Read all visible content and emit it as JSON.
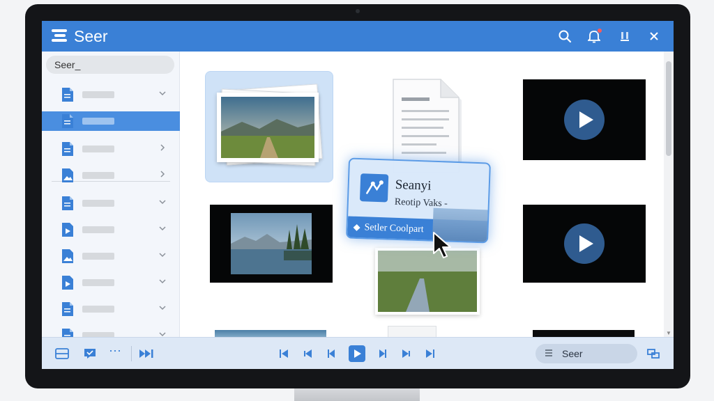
{
  "app": {
    "title": "Seer",
    "accent": "#3a80d6"
  },
  "titlebar": {
    "icons": [
      "search-icon",
      "bell-icon",
      "minimize-icon",
      "close-icon"
    ]
  },
  "sidebar": {
    "search_value": "Seer_",
    "selected_index": 1,
    "items": [
      {
        "icon": "document-icon",
        "chevron": "down"
      },
      {
        "icon": "document-icon",
        "chevron": "none"
      },
      {
        "icon": "document-icon",
        "chevron": "right"
      },
      {
        "icon": "image-icon",
        "chevron": "right"
      },
      {
        "icon": "document-icon",
        "chevron": "down"
      },
      {
        "icon": "video-icon",
        "chevron": "down"
      },
      {
        "icon": "image-icon",
        "chevron": "down"
      },
      {
        "icon": "video-icon",
        "chevron": "down"
      },
      {
        "icon": "document-icon",
        "chevron": "down"
      },
      {
        "icon": "document-icon",
        "chevron": "down"
      }
    ]
  },
  "drag_card": {
    "title": "Seanyi",
    "subtitle": "Reotip Vaks -",
    "footer_label": "Setler Coolpart"
  },
  "bottombar": {
    "search_value": "Seer",
    "icons": [
      "panel-icon",
      "chat-icon",
      "more-icon",
      "fast-forward-icon",
      "skip-back-icon",
      "rewind-icon",
      "step-back-icon",
      "play-icon",
      "step-forward-icon",
      "forward-icon",
      "skip-forward-icon",
      "settings-icon"
    ]
  }
}
